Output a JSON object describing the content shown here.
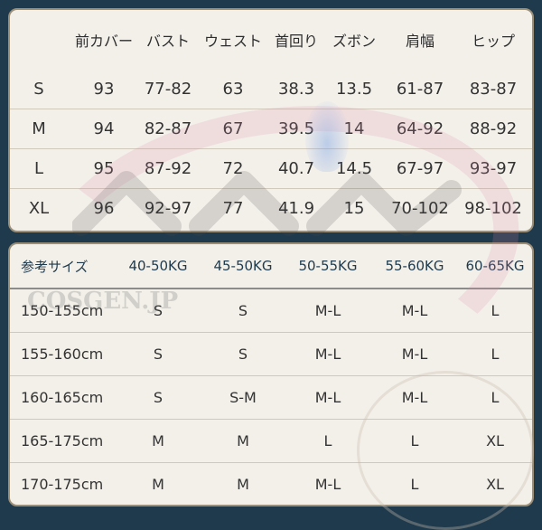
{
  "measurements": {
    "headers": [
      "",
      "前カバー",
      "バスト",
      "ウェスト",
      "首回り",
      "ズボン",
      "肩幅",
      "ヒップ"
    ],
    "rows": [
      [
        "S",
        "93",
        "77-82",
        "63",
        "38.3",
        "13.5",
        "61-87",
        "83-87"
      ],
      [
        "M",
        "94",
        "82-87",
        "67",
        "39.5",
        "14",
        "64-92",
        "88-92"
      ],
      [
        "L",
        "95",
        "87-92",
        "72",
        "40.7",
        "14.5",
        "67-97",
        "93-97"
      ],
      [
        "XL",
        "96",
        "92-97",
        "77",
        "41.9",
        "15",
        "70-102",
        "98-102"
      ]
    ]
  },
  "reference": {
    "headers": [
      "参考サイズ",
      "40-50KG",
      "45-50KG",
      "50-55KG",
      "55-60KG",
      "60-65KG"
    ],
    "rows": [
      [
        "150-155cm",
        "S",
        "S",
        "M-L",
        "M-L",
        "L"
      ],
      [
        "155-160cm",
        "S",
        "S",
        "M-L",
        "M-L",
        "L"
      ],
      [
        "160-165cm",
        "S",
        "S-M",
        "M-L",
        "M-L",
        "L"
      ],
      [
        "165-175cm",
        "M",
        "M",
        "L",
        "L",
        "XL"
      ],
      [
        "170-175cm",
        "M",
        "M",
        "M-L",
        "L",
        "XL"
      ]
    ]
  },
  "watermark": {
    "site_text": "COSGEN.JP"
  },
  "colors": {
    "background": "#1f3a4c",
    "panel": "#f3f0ea",
    "panel_border": "#9c8f78"
  }
}
